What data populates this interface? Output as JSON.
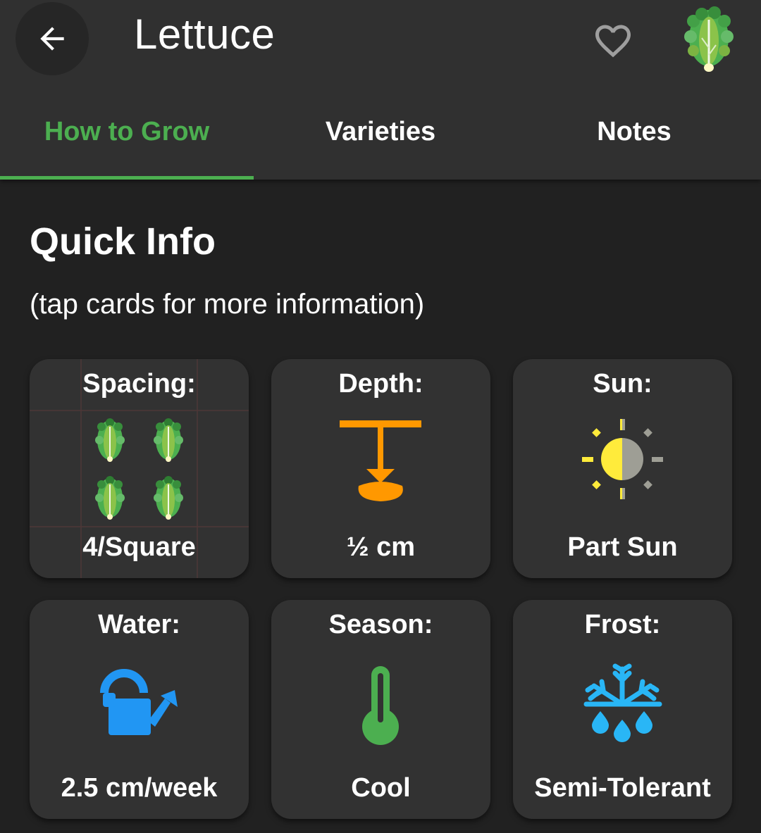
{
  "header": {
    "title": "Lettuce",
    "back_icon": "arrow-left-icon",
    "favorite_icon": "heart-outline-icon",
    "plant_icon": "lettuce-icon"
  },
  "tabs": [
    {
      "label": "How to Grow",
      "active": true
    },
    {
      "label": "Varieties",
      "active": false
    },
    {
      "label": "Notes",
      "active": false
    }
  ],
  "quick_info": {
    "heading": "Quick Info",
    "hint": "(tap cards for more information)",
    "cards": [
      {
        "label": "Spacing:",
        "value": "4/Square",
        "icon": "lettuce-grid-icon"
      },
      {
        "label": "Depth:",
        "value": "½ cm",
        "icon": "seed-depth-icon"
      },
      {
        "label": "Sun:",
        "value": "Part Sun",
        "icon": "part-sun-icon"
      },
      {
        "label": "Water:",
        "value": "2.5 cm/week",
        "icon": "watering-can-icon"
      },
      {
        "label": "Season:",
        "value": "Cool",
        "icon": "thermometer-icon"
      },
      {
        "label": "Frost:",
        "value": "Semi-Tolerant",
        "icon": "frost-icon"
      }
    ]
  },
  "colors": {
    "accent": "#4caf50",
    "background": "#212121",
    "appbar": "#303030",
    "card": "#323232",
    "depth_orange": "#ff9800",
    "sun_yellow": "#ffeb3b",
    "water_blue": "#2196f3",
    "frost_blue": "#29b6f6"
  }
}
